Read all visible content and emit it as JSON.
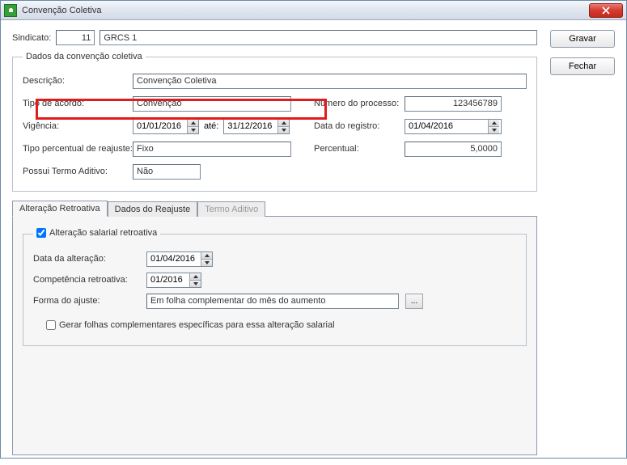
{
  "window": {
    "title": "Convenção Coletiva",
    "close_tooltip": "Fechar"
  },
  "sidebar": {
    "save_btn": "Gravar",
    "close_btn": "Fechar"
  },
  "header": {
    "sindicato_label": "Sindicato:",
    "sindicato_code": "11",
    "sindicato_name": "GRCS 1"
  },
  "groupbox": {
    "title": "Dados da convenção coletiva",
    "descricao_label": "Descrição:",
    "descricao_value": "Convenção Coletiva",
    "tipo_acordo_label": "Tipo de acordo:",
    "tipo_acordo_value": "Convenção",
    "numero_processo_label": "Número do processo:",
    "numero_processo_value": "123456789",
    "vigencia_label": "Vigência:",
    "vigencia_ini": "01/01/2016",
    "vigencia_ate_label": "até:",
    "vigencia_fim": "31/12/2016",
    "data_registro_label": "Data do registro:",
    "data_registro_value": "01/04/2016",
    "tipo_percentual_label": "Tipo percentual de reajuste:",
    "tipo_percentual_value": "Fixo",
    "percentual_label": "Percentual:",
    "percentual_value": "5,0000",
    "possui_termo_label": "Possui Termo Aditivo:",
    "possui_termo_value": "Não"
  },
  "tabs": {
    "tab1": "Alteração Retroativa",
    "tab2": "Dados do Reajuste",
    "tab3": "Termo Aditivo"
  },
  "retro": {
    "group_title": "Alteração salarial retroativa",
    "data_alteracao_label": "Data da alteração:",
    "data_alteracao_value": "01/04/2016",
    "competencia_label": "Competência retroativa:",
    "competencia_value": "01/2016",
    "forma_label": "Forma do ajuste:",
    "forma_value": "Em folha complementar do mês do aumento",
    "gerar_folhas_label": "Gerar folhas complementares específicas para essa alteração salarial"
  }
}
